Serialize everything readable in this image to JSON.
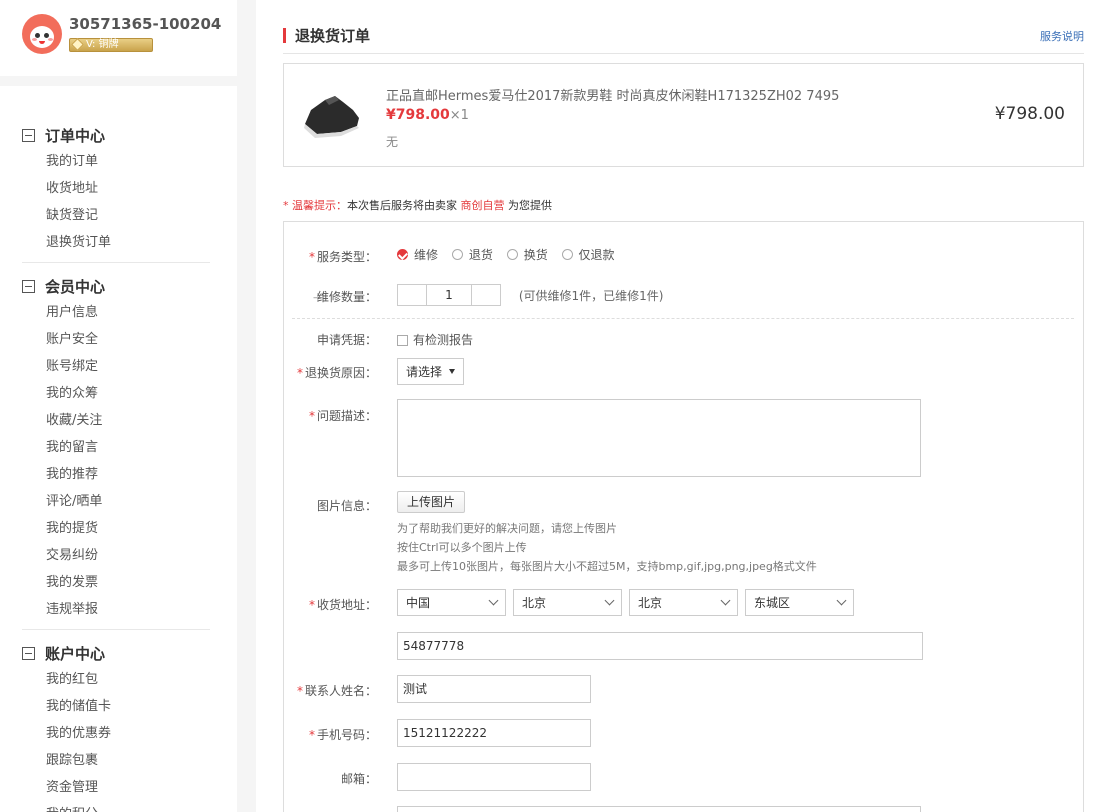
{
  "user": {
    "id": "30571365-100204",
    "vip": "V: 铜牌"
  },
  "nav": [
    {
      "title": "订单中心",
      "items": [
        "我的订单",
        "收货地址",
        "缺货登记",
        "退换货订单"
      ]
    },
    {
      "title": "会员中心",
      "items": [
        "用户信息",
        "账户安全",
        "账号绑定",
        "我的众筹",
        "收藏/关注",
        "我的留言",
        "我的推荐",
        "评论/晒单",
        "我的提货",
        "交易纠纷",
        "我的发票",
        "违规举报"
      ]
    },
    {
      "title": "账户中心",
      "items": [
        "我的红包",
        "我的储值卡",
        "我的优惠券",
        "跟踪包裹",
        "资金管理",
        "我的积分"
      ]
    }
  ],
  "page": {
    "title": "退换货订单",
    "service_link": "服务说明"
  },
  "product": {
    "name": "正品直邮Hermes爱马仕2017新款男鞋 时尚真皮休闲鞋H171325ZH02 7495",
    "price": "¥798.00",
    "qty": "×1",
    "spec": "无",
    "total": "¥798.00"
  },
  "tip": {
    "star": "*",
    "label": "温馨提示：",
    "text1": "本次售后服务将由卖家",
    "seller": "商创自营",
    "text2": "为您提供"
  },
  "form": {
    "service_type": {
      "label": "服务类型：",
      "options": [
        "维修",
        "退货",
        "换货",
        "仅退款"
      ],
      "selected": "维修"
    },
    "quantity": {
      "label": "维修数量：",
      "value": "1",
      "hint": "(可供维修1件，已维修1件)"
    },
    "evidence": {
      "label": "申请凭据：",
      "option": "有检测报告"
    },
    "reason": {
      "label": "退换货原因：",
      "value": "请选择"
    },
    "description": {
      "label": "问题描述："
    },
    "images": {
      "label": "图片信息：",
      "button": "上传图片",
      "hints": [
        "为了帮助我们更好的解决问题，请您上传图片",
        "按住Ctrl可以多个图片上传",
        "最多可上传10张图片，每张图片大小不超过5M，支持bmp,gif,jpg,png,jpeg格式文件"
      ]
    },
    "address": {
      "label": "收货地址：",
      "country": "中国",
      "province": "北京",
      "city": "北京",
      "district": "东城区",
      "detail": "54877778"
    },
    "contact": {
      "label": "联系人姓名：",
      "value": "测试"
    },
    "phone": {
      "label": "手机号码：",
      "value": "15121122222"
    },
    "email": {
      "label": "邮箱：",
      "value": ""
    }
  },
  "colors": {
    "accent": "#e4393c",
    "link": "#3a6fb7",
    "vip": "#c9a34c"
  }
}
